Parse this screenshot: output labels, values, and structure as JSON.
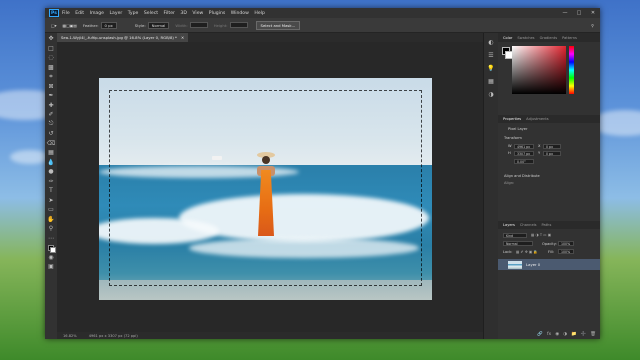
{
  "app": {
    "logo": "Ps",
    "menus": [
      "File",
      "Edit",
      "Image",
      "Layer",
      "Type",
      "Select",
      "Filter",
      "3D",
      "View",
      "Plugins",
      "Window",
      "Help"
    ]
  },
  "options": {
    "feather_label": "Feather:",
    "feather_value": "0 px",
    "style_label": "Style:",
    "style_value": "Normal",
    "width_label": "Width:",
    "height_label": "Height:",
    "select_mask_label": "Select and Mask..."
  },
  "document": {
    "tab_title": "Sea-1-Wyjl4l_-fu9ip-unsplash.jpg @ 16.8% (Layer 0, RGB/8) *"
  },
  "status": {
    "zoom": "16.82%",
    "dimensions": "4961 px x 3307 px (72 ppi)"
  },
  "panels": {
    "color_tabs": [
      "Color",
      "Swatches",
      "Gradients",
      "Patterns"
    ],
    "properties_tabs": [
      "Properties",
      "Adjustments"
    ],
    "pixel_layer": "Pixel Layer",
    "transform_label": "Transform",
    "w_value": "4961 px",
    "h_value": "3307 px",
    "x_value": "0 px",
    "y_value": "0 px",
    "angle_value": "0.00°",
    "align_label": "Align and Distribute",
    "align_sub": "Align:",
    "layers_tabs": [
      "Layers",
      "Channels",
      "Paths"
    ],
    "kind_label": "Kind",
    "blend_mode": "Normal",
    "opacity_label": "Opacity:",
    "opacity_value": "100%",
    "lock_label": "Lock:",
    "fill_label": "Fill:",
    "fill_value": "100%",
    "layer_name": "Layer 0"
  },
  "colors": {
    "accent": "#31a8ff",
    "foreground": "#000000",
    "background": "#ffffff"
  }
}
